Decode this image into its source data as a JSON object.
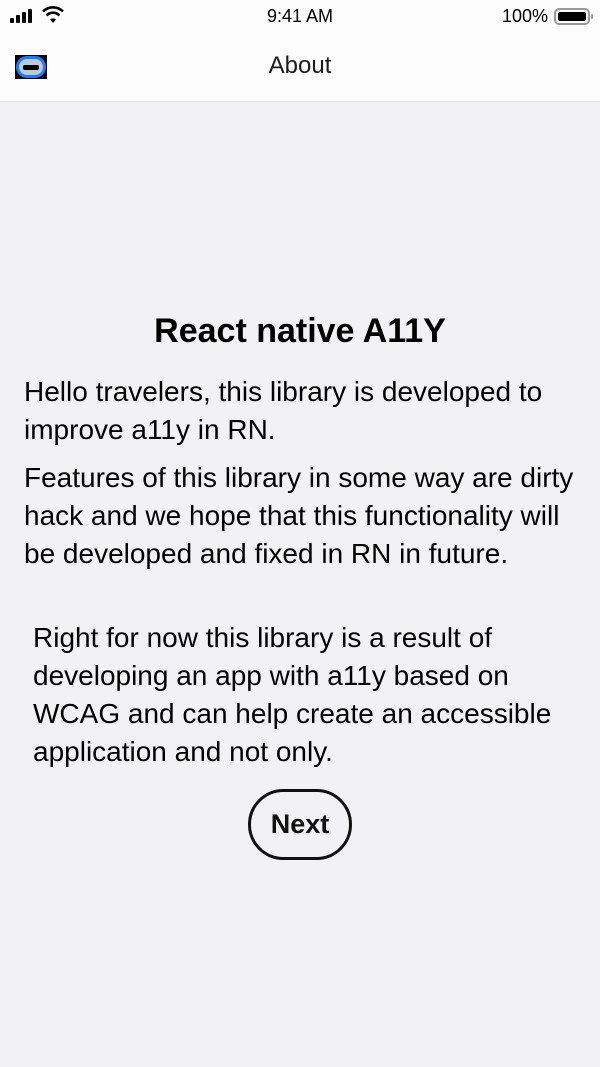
{
  "status_bar": {
    "time": "9:41 AM",
    "battery": "100%"
  },
  "nav": {
    "title": "About",
    "menu_icon": "menu-icon"
  },
  "content": {
    "title": "React native A11Y",
    "paragraphs": [
      "Hello travelers, this library is developed to improve a11y in RN.",
      "Features of this library in some way are dirty hack and we hope that this functionality will be developed and fixed in RN in future.",
      "Right for now this library is a result of developing an app with a11y based on WCAG and can help create an accessible application and not only."
    ],
    "next_label": "Next"
  }
}
